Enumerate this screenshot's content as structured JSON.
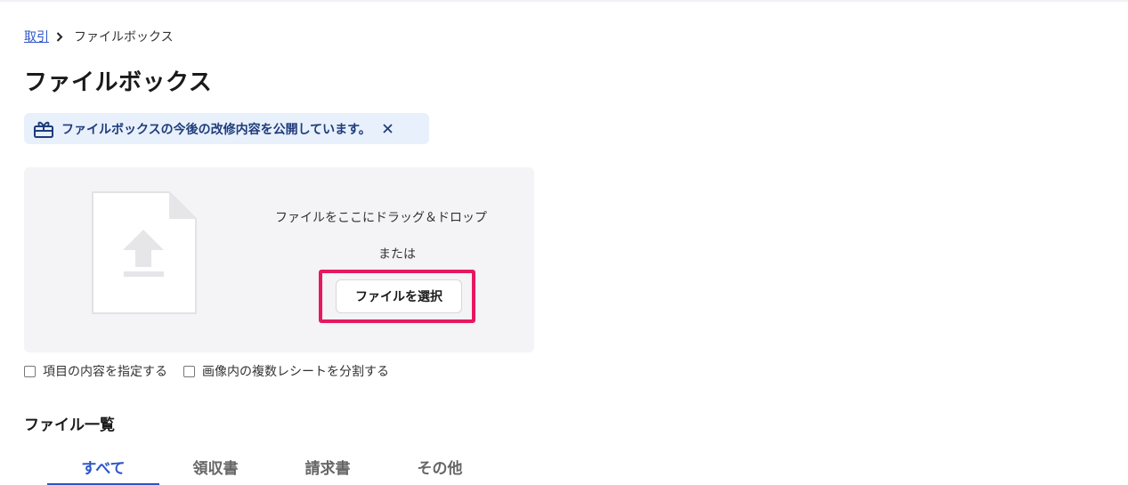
{
  "breadcrumb": {
    "parent": "取引",
    "current": "ファイルボックス"
  },
  "page": {
    "title": "ファイルボックス"
  },
  "notice": {
    "text": "ファイルボックスの今後の改修内容を公開しています。"
  },
  "dropzone": {
    "instruction": "ファイルをここにドラッグ＆ドロップ",
    "or": "または",
    "select_button": "ファイルを選択"
  },
  "options": {
    "specify_items": "項目の内容を指定する",
    "split_receipts": "画像内の複数レシートを分割する"
  },
  "file_list": {
    "title": "ファイル一覧",
    "tabs": [
      {
        "label": "すべて",
        "active": true
      },
      {
        "label": "領収書",
        "active": false
      },
      {
        "label": "請求書",
        "active": false
      },
      {
        "label": "その他",
        "active": false
      }
    ]
  },
  "colors": {
    "accent": "#2c55c9",
    "highlight": "#e6185f",
    "notice_bg": "#e8f0fc",
    "dropzone_bg": "#f4f3f5"
  }
}
